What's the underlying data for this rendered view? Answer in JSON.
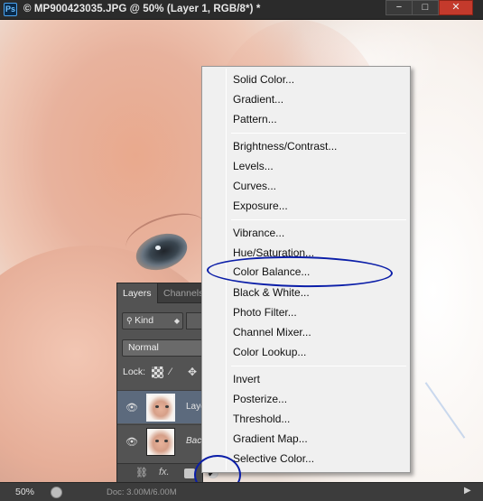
{
  "window": {
    "app_icon": "Ps",
    "title": "© MP900423035.JPG @ 50% (Layer 1, RGB/8*) *",
    "minimize": "−",
    "maximize": "□",
    "close": "✕"
  },
  "layers_panel": {
    "tabs": [
      {
        "label": "Layers"
      },
      {
        "label": "Channels"
      }
    ],
    "kind_filter": "Kind",
    "blend_mode": "Normal",
    "lock_label": "Lock:",
    "layers": [
      {
        "name": "Laye",
        "selected": true
      },
      {
        "name": "Bac",
        "selected": false
      }
    ],
    "bottom_icons": [
      "link-icon",
      "fx-icon",
      "mask-icon",
      "adjustment-icon",
      "folder-icon",
      "new-layer-icon",
      "trash-icon"
    ],
    "fx_label": "fx."
  },
  "adjustment_menu": {
    "groups": [
      [
        "Solid Color...",
        "Gradient...",
        "Pattern..."
      ],
      [
        "Brightness/Contrast...",
        "Levels...",
        "Curves...",
        "Exposure..."
      ],
      [
        "Vibrance...",
        "Hue/Saturation...",
        "Color Balance...",
        "Black & White...",
        "Photo Filter...",
        "Channel Mixer...",
        "Color Lookup..."
      ],
      [
        "Invert",
        "Posterize...",
        "Threshold...",
        "Gradient Map...",
        "Selective Color..."
      ]
    ],
    "circled_item": "Color Balance..."
  },
  "status_bar": {
    "zoom": "50%",
    "doc_info": "Doc: 3.00M/6.00M",
    "arrow": "▶"
  },
  "colors": {
    "annotation_circle": "#0b1ea8",
    "menu_bg": "#f0f0f0",
    "panel_bg": "#535353"
  }
}
